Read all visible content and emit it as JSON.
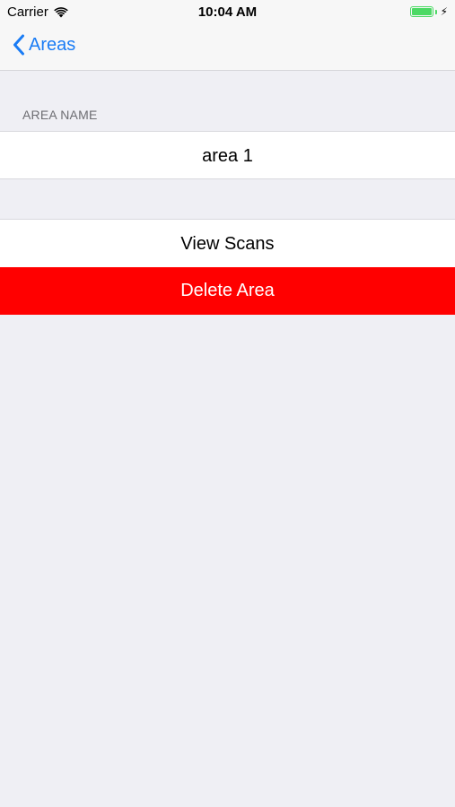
{
  "status_bar": {
    "carrier": "Carrier",
    "time": "10:04 AM"
  },
  "nav": {
    "back_label": "Areas"
  },
  "section": {
    "header": "AREA NAME",
    "name_value": "area 1"
  },
  "actions": {
    "view_scans": "View Scans",
    "delete_area": "Delete Area"
  },
  "colors": {
    "accent": "#1a7cf5",
    "destructive": "#ff0000",
    "battery": "#4cd964",
    "background": "#efeff4"
  }
}
